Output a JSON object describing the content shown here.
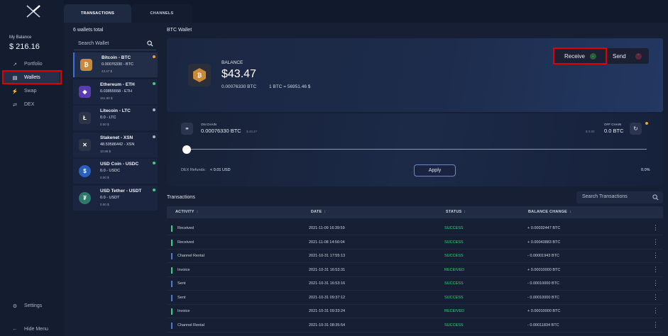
{
  "sidebar": {
    "balance_label": "My Balance",
    "balance_value": "$ 216.16",
    "items": [
      {
        "label": "Portfolio",
        "icon": "chart-icon"
      },
      {
        "label": "Wallets",
        "icon": "wallet-icon"
      },
      {
        "label": "Swap",
        "icon": "bolt-icon"
      },
      {
        "label": "DEX",
        "icon": "exchange-icon"
      }
    ],
    "settings_label": "Settings",
    "hide_menu_label": "Hide Menu"
  },
  "tabs": [
    {
      "label": "TRANSACTIONS"
    },
    {
      "label": "CHANNELS"
    }
  ],
  "wallets": {
    "total_label": "6 wallets total",
    "search_placeholder": "Search Wallet",
    "list": [
      {
        "name": "Bitcoin - BTC",
        "amount": "0.00076330 - BTC",
        "usd": "43.47 $",
        "icon": "bitcoin-icon",
        "color": "#c88a3a",
        "status_color": "#f0a030"
      },
      {
        "name": "Ethereum - ETH",
        "amount": "0.03855558 - ETH",
        "usd": "161.80 $",
        "icon": "ethereum-icon",
        "color": "#5b3bb0",
        "status_color": "#3ecf7a"
      },
      {
        "name": "Litecoin - LTC",
        "amount": "0.0 - LTC",
        "usd": "0.00 $",
        "icon": "litecoin-icon",
        "color": "#2c3448",
        "status_color": "#aab3c4"
      },
      {
        "name": "Stakenet - XSN",
        "amount": "48.59586442 - XSN",
        "usd": "10.89 $",
        "icon": "stakenet-icon",
        "color": "#2c3448",
        "status_color": "#aab3c4"
      },
      {
        "name": "USD Coin - USDC",
        "amount": "0.0 - USDC",
        "usd": "0.00 $",
        "icon": "usdc-icon",
        "color": "#2860c0",
        "status_color": "#3ecf7a"
      },
      {
        "name": "USD Tether - USDT",
        "amount": "0.0 - USDT",
        "usd": "0.00 $",
        "icon": "tether-icon",
        "color": "#2c7a6a",
        "status_color": "#3ecf7a"
      }
    ]
  },
  "detail": {
    "title": "BTC Wallet",
    "balance_caption": "BALANCE",
    "balance_value": "$43.47",
    "balance_btc": "0.00076330 BTC",
    "rate": "1 BTC = 56951.46 $",
    "receive_label": "Receive",
    "send_label": "Send"
  },
  "channels": {
    "on_chain_caption": "ON CHAIN",
    "on_chain_value": "0.00076330 BTC",
    "on_chain_usd": "$ 43.47",
    "off_chain_caption": "OFF CHAIN",
    "off_chain_value": "0.0 BTC",
    "off_chain_usd": "$ 0.00",
    "slider_position": 0,
    "refunds_label": "DEX Refunds:",
    "refunds_value": "< 0.01 USD",
    "apply_label": "Apply",
    "percent": "0.0%"
  },
  "transactions": {
    "title": "Transactions",
    "search_placeholder": "Search Transactions",
    "columns": [
      "ACTIVITY",
      "DATE",
      "STATUS",
      "BALANCE CHANGE"
    ],
    "rows": [
      {
        "activity": "Received",
        "date": "2021-11-09 16:39:59",
        "status": "SUCCESS",
        "change": "+ 0.00032447 BTC",
        "color": "#3ecf7a"
      },
      {
        "activity": "Received",
        "date": "2021-11-08 14:56:04",
        "status": "SUCCESS",
        "change": "+ 0.00043883 BTC",
        "color": "#3ecf7a"
      },
      {
        "activity": "Channel Rental",
        "date": "2021-10-31 17:55:13",
        "status": "SUCCESS",
        "change": "- 0.00001943 BTC",
        "color": "#4a7ad8"
      },
      {
        "activity": "Invoice",
        "date": "2021-10-31 16:53:31",
        "status": "RECEIVED",
        "change": "+ 0.00010000 BTC",
        "color": "#3ecf7a"
      },
      {
        "activity": "Sent",
        "date": "2021-10-31 16:53:16",
        "status": "SUCCESS",
        "change": "- 0.00010000 BTC",
        "color": "#4a7ad8"
      },
      {
        "activity": "Sent",
        "date": "2021-10-31 09:37:12",
        "status": "SUCCESS",
        "change": "- 0.00010000 BTC",
        "color": "#4a7ad8"
      },
      {
        "activity": "Invoice",
        "date": "2021-10-31 09:33:24",
        "status": "RECEIVED",
        "change": "+ 0.00010000 BTC",
        "color": "#3ecf7a"
      },
      {
        "activity": "Channel Rental",
        "date": "2021-10-31 08:35:54",
        "status": "SUCCESS",
        "change": "- 0.00011834 BTC",
        "color": "#4a7ad8"
      }
    ]
  },
  "colors": {
    "success": "#3ecf7a",
    "accent": "#3c6fe0",
    "highlight": "#e00000"
  }
}
